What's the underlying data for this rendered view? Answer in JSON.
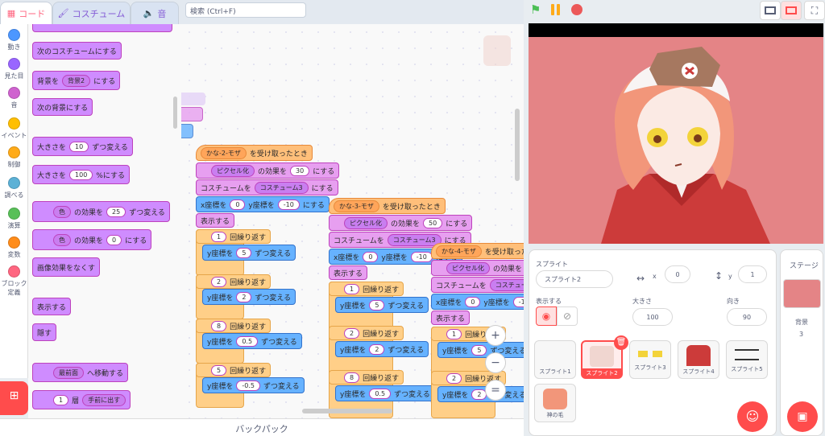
{
  "tabs": {
    "code": "コード",
    "costume": "コスチューム",
    "sound": "音"
  },
  "search": {
    "placeholder": "検索 (Ctrl+F)"
  },
  "categories": [
    {
      "label": "動き",
      "color": "#4c97ff"
    },
    {
      "label": "見た目",
      "color": "#9966ff"
    },
    {
      "label": "音",
      "color": "#cf63cf"
    },
    {
      "label": "イベント",
      "color": "#ffbf00"
    },
    {
      "label": "制御",
      "color": "#ffab19"
    },
    {
      "label": "調べる",
      "color": "#5cb1d6"
    },
    {
      "label": "演算",
      "color": "#59c059"
    },
    {
      "label": "変数",
      "color": "#ff8c1a"
    },
    {
      "label": "ブロック定義",
      "color": "#ff6680"
    }
  ],
  "palette": {
    "next_costume": "次のコスチュームにする",
    "switch_backdrop": "背景を",
    "backdrop_value": "背景2",
    "switch_backdrop_suffix": "にする",
    "next_backdrop": "次の背景にする",
    "change_size": "大きさを",
    "change_size_value": "10",
    "change_size_suffix": "ずつ変える",
    "set_size": "大きさを",
    "set_size_value": "100",
    "set_size_suffix": "%にする",
    "effect_dd": "色",
    "change_effect_mid": "の効果を",
    "change_effect_value": "25",
    "change_effect_suffix": "ずつ変える",
    "set_effect_value": "0",
    "set_effect_suffix": "にする",
    "clear_effects": "画像効果をなくす",
    "show": "表示する",
    "hide": "隠す",
    "front_dd": "最前面",
    "go_to_layer": "へ移動する",
    "layer_value": "1",
    "layer_label": "層",
    "layer_dd": "手前に出す"
  },
  "scripts": {
    "hat1": "かな-2-モザ",
    "hat2": "かな-3-モザ",
    "hat3": "かな-4-モザ",
    "hat_suffix": "を受け取ったとき",
    "pixelate": "ピクセル化",
    "effect_mid": "の効果を",
    "effect_suffix": "にする",
    "pix1": "30",
    "pix2": "50",
    "costume_label": "コスチュームを",
    "costume_value": "コスチューム3",
    "costume_suffix": "にする",
    "x_label": "x座標を",
    "x_value": "0",
    "y_label": "y座標を",
    "y_value": "-10",
    "y_suffix": "にする",
    "show": "表示する",
    "repeat_label": "回繰り返す",
    "repeat_value": "1",
    "repeat_value2": "2",
    "repeat_value3": "8",
    "repeat_value4": "5",
    "change_y": "y座標を",
    "change_y_suffix": "ずつ変える",
    "cy1": "5",
    "cy2": "2",
    "cy3": "0.5",
    "cy4": "-0.5"
  },
  "backpack": "バックパック",
  "sprite_info": {
    "label": "スプライト",
    "name": "スプライト2",
    "x_label": "x",
    "x_value": "0",
    "y_label": "y",
    "y_value": "1",
    "show_label": "表示する",
    "size_label": "大きさ",
    "size_value": "100",
    "direction_label": "向き",
    "direction_value": "90"
  },
  "sprites": [
    "スプライト1",
    "スプライト2",
    "スプライト3",
    "スプライト4",
    "スプライト5",
    "神の毛"
  ],
  "stage_panel": {
    "title": "ステージ",
    "backdrops_label": "背景",
    "backdrops_count": "3"
  },
  "colors": {
    "accent": "#ff4c4c",
    "stage_bg": "#e48486",
    "looks": "#9966ff"
  }
}
